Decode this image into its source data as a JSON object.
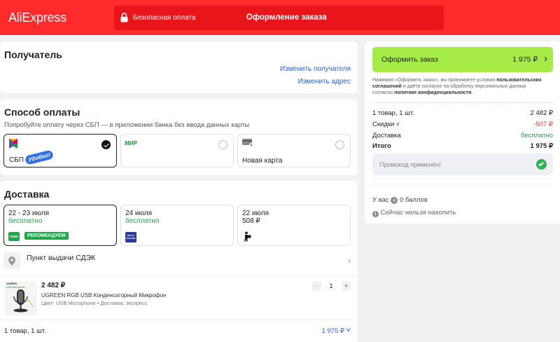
{
  "header": {
    "logo": "AliExpress",
    "secure_text": "Безопасная оплата",
    "checkout_text": "Оформление заказа"
  },
  "recipient": {
    "title": "Получатель",
    "change_recipient": "Изменить получателя",
    "change_address": "Изменить адрес"
  },
  "payment": {
    "title": "Способ оплаты",
    "hint": "Попробуйте оплату через СБП — в приложении банка без ввода данных карты",
    "options": [
      {
        "label": "СБП",
        "badge": "Удобно!",
        "selected": true
      },
      {
        "logo": "МИР",
        "selected": false
      },
      {
        "label": "Новая карта",
        "selected": false
      }
    ]
  },
  "delivery": {
    "title": "Доставка",
    "options": [
      {
        "date": "22 - 23 июля",
        "price": "бесплатно",
        "carrier_logo": "CDEK",
        "badge": "РЕКОМЕНДУЕМ",
        "selected": true
      },
      {
        "date": "24 июля",
        "price": "бесплатно",
        "carrier_logo": "ПОЧТА РОССИИ",
        "selected": false
      },
      {
        "date": "22 июля",
        "price": "508 ₽",
        "selected": false
      }
    ],
    "pickup": "Пункт выдачи СДЭК"
  },
  "product": {
    "image_caption": "UGREEN",
    "image_subcaption": "USB Microphone",
    "price": "2 482 ₽",
    "name": "UGREEN RGB USB Конденсаторный Микрофон",
    "meta": "Цвет: USB Microphone • Доставка: экспресс",
    "quantity": "1",
    "minus": "−",
    "plus": "+"
  },
  "footer": {
    "count": "1 товар, 1 шт.",
    "total": "1 975 ₽"
  },
  "summary": {
    "order_button_label": "Оформить заказ",
    "order_button_price": "1 975 ₽",
    "terms_a": "Нажимая «Оформить заказ», вы принимаете условия ",
    "terms_b": "пользовательских соглашений",
    "terms_c": " и даёте согласие на обработку персональных данных согласно ",
    "terms_d": "политике конфиденциальности",
    "terms_e": ".",
    "items_label": "1 товар, 1 шт.",
    "items_value": "2 482 ₽",
    "discount_label": "Скидки",
    "discount_value": "-507 ₽",
    "delivery_label": "Доставка",
    "delivery_value": "бесплатно",
    "total_label": "Итого",
    "total_value": "1 975 ₽",
    "promo_text": "Промокод применён!",
    "points_prefix": "У вас",
    "points_value": "0 баллов",
    "points_note": "Сейчас нельзя накопить"
  },
  "colors": {
    "header_red": "#fe2a2b",
    "order_button": "#a6eb49",
    "link_blue": "#2962d9",
    "free_green": "#18a94b",
    "discount_red": "#e53935"
  }
}
